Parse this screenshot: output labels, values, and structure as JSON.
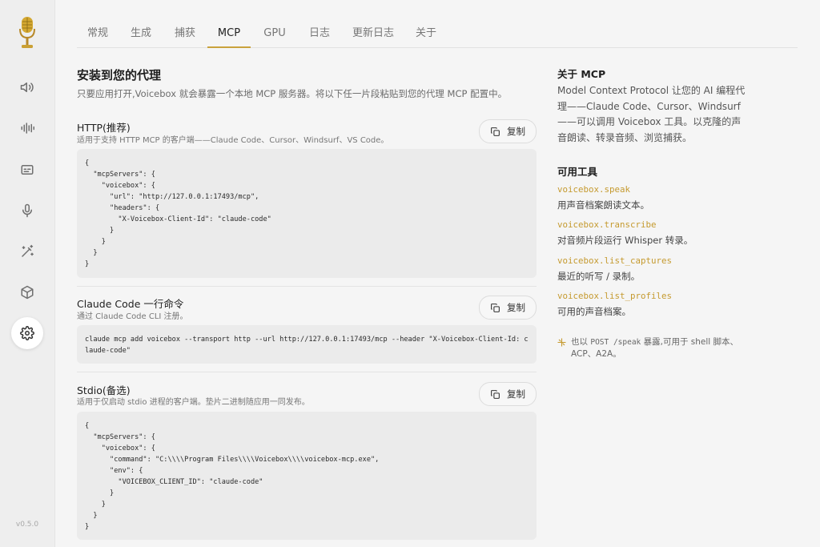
{
  "sidebar": {
    "items": [
      {
        "name": "speaker-icon"
      },
      {
        "name": "waveform-icon"
      },
      {
        "name": "subtitles-icon"
      },
      {
        "name": "microphone-icon"
      },
      {
        "name": "magic-wand-icon"
      },
      {
        "name": "box-icon"
      },
      {
        "name": "settings-gear-icon",
        "active": true
      }
    ],
    "version": "v0.5.0"
  },
  "tabs": [
    {
      "label": "常规"
    },
    {
      "label": "生成"
    },
    {
      "label": "捕获"
    },
    {
      "label": "MCP",
      "active": true
    },
    {
      "label": "GPU"
    },
    {
      "label": "日志"
    },
    {
      "label": "更新日志"
    },
    {
      "label": "关于"
    }
  ],
  "main": {
    "title": "安装到您的代理",
    "subtitle": "只要应用打开,Voicebox 就会暴露一个本地 MCP 服务器。将以下任一片段粘贴到您的代理 MCP 配置中。",
    "copy_label": "复制",
    "sections": {
      "http": {
        "title": "HTTP(推荐)",
        "desc": "适用于支持 HTTP MCP 的客户端——Claude Code、Cursor、Windsurf、VS Code。",
        "code": "{\n  \"mcpServers\": {\n    \"voicebox\": {\n      \"url\": \"http://127.0.0.1:17493/mcp\",\n      \"headers\": {\n        \"X-Voicebox-Client-Id\": \"claude-code\"\n      }\n    }\n  }\n}"
      },
      "claude": {
        "title": "Claude Code 一行命令",
        "desc": "通过 Claude Code CLI 注册。",
        "code": "claude mcp add voicebox --transport http --url http://127.0.0.1:17493/mcp --header \"X-Voicebox-Client-Id: claude-code\""
      },
      "stdio": {
        "title": "Stdio(备选)",
        "desc": "适用于仅启动 stdio 进程的客户端。垫片二进制随应用一同发布。",
        "code": "{\n  \"mcpServers\": {\n    \"voicebox\": {\n      \"command\": \"C:\\\\\\\\Program Files\\\\\\\\Voicebox\\\\\\\\voicebox-mcp.exe\",\n      \"env\": {\n        \"VOICEBOX_CLIENT_ID\": \"claude-code\"\n      }\n    }\n  }\n}"
      }
    }
  },
  "aside": {
    "about_title": "关于 MCP",
    "about_text": "Model Context Protocol 让您的 AI 编程代理——Claude Code、Cursor、Windsurf——可以调用 Voicebox 工具。以克隆的声音朗读、转录音频、浏览捕获。",
    "tools_title": "可用工具",
    "tools": [
      {
        "name": "voicebox.speak",
        "desc": "用声音档案朗读文本。"
      },
      {
        "name": "voicebox.transcribe",
        "desc": "对音频片段运行 Whisper 转录。"
      },
      {
        "name": "voicebox.list_captures",
        "desc": "最近的听写 / 录制。"
      },
      {
        "name": "voicebox.list_profiles",
        "desc": "可用的声音档案。"
      }
    ],
    "note_prefix": "也以",
    "note_code": "POST /speak",
    "note_suffix": "暴露,可用于 shell 脚本、ACP、A2A。"
  },
  "colors": {
    "accent": "#c9a23c",
    "tool_name": "#c59a2f",
    "background": "#f5f5f5",
    "code_bg": "#ebebeb"
  }
}
